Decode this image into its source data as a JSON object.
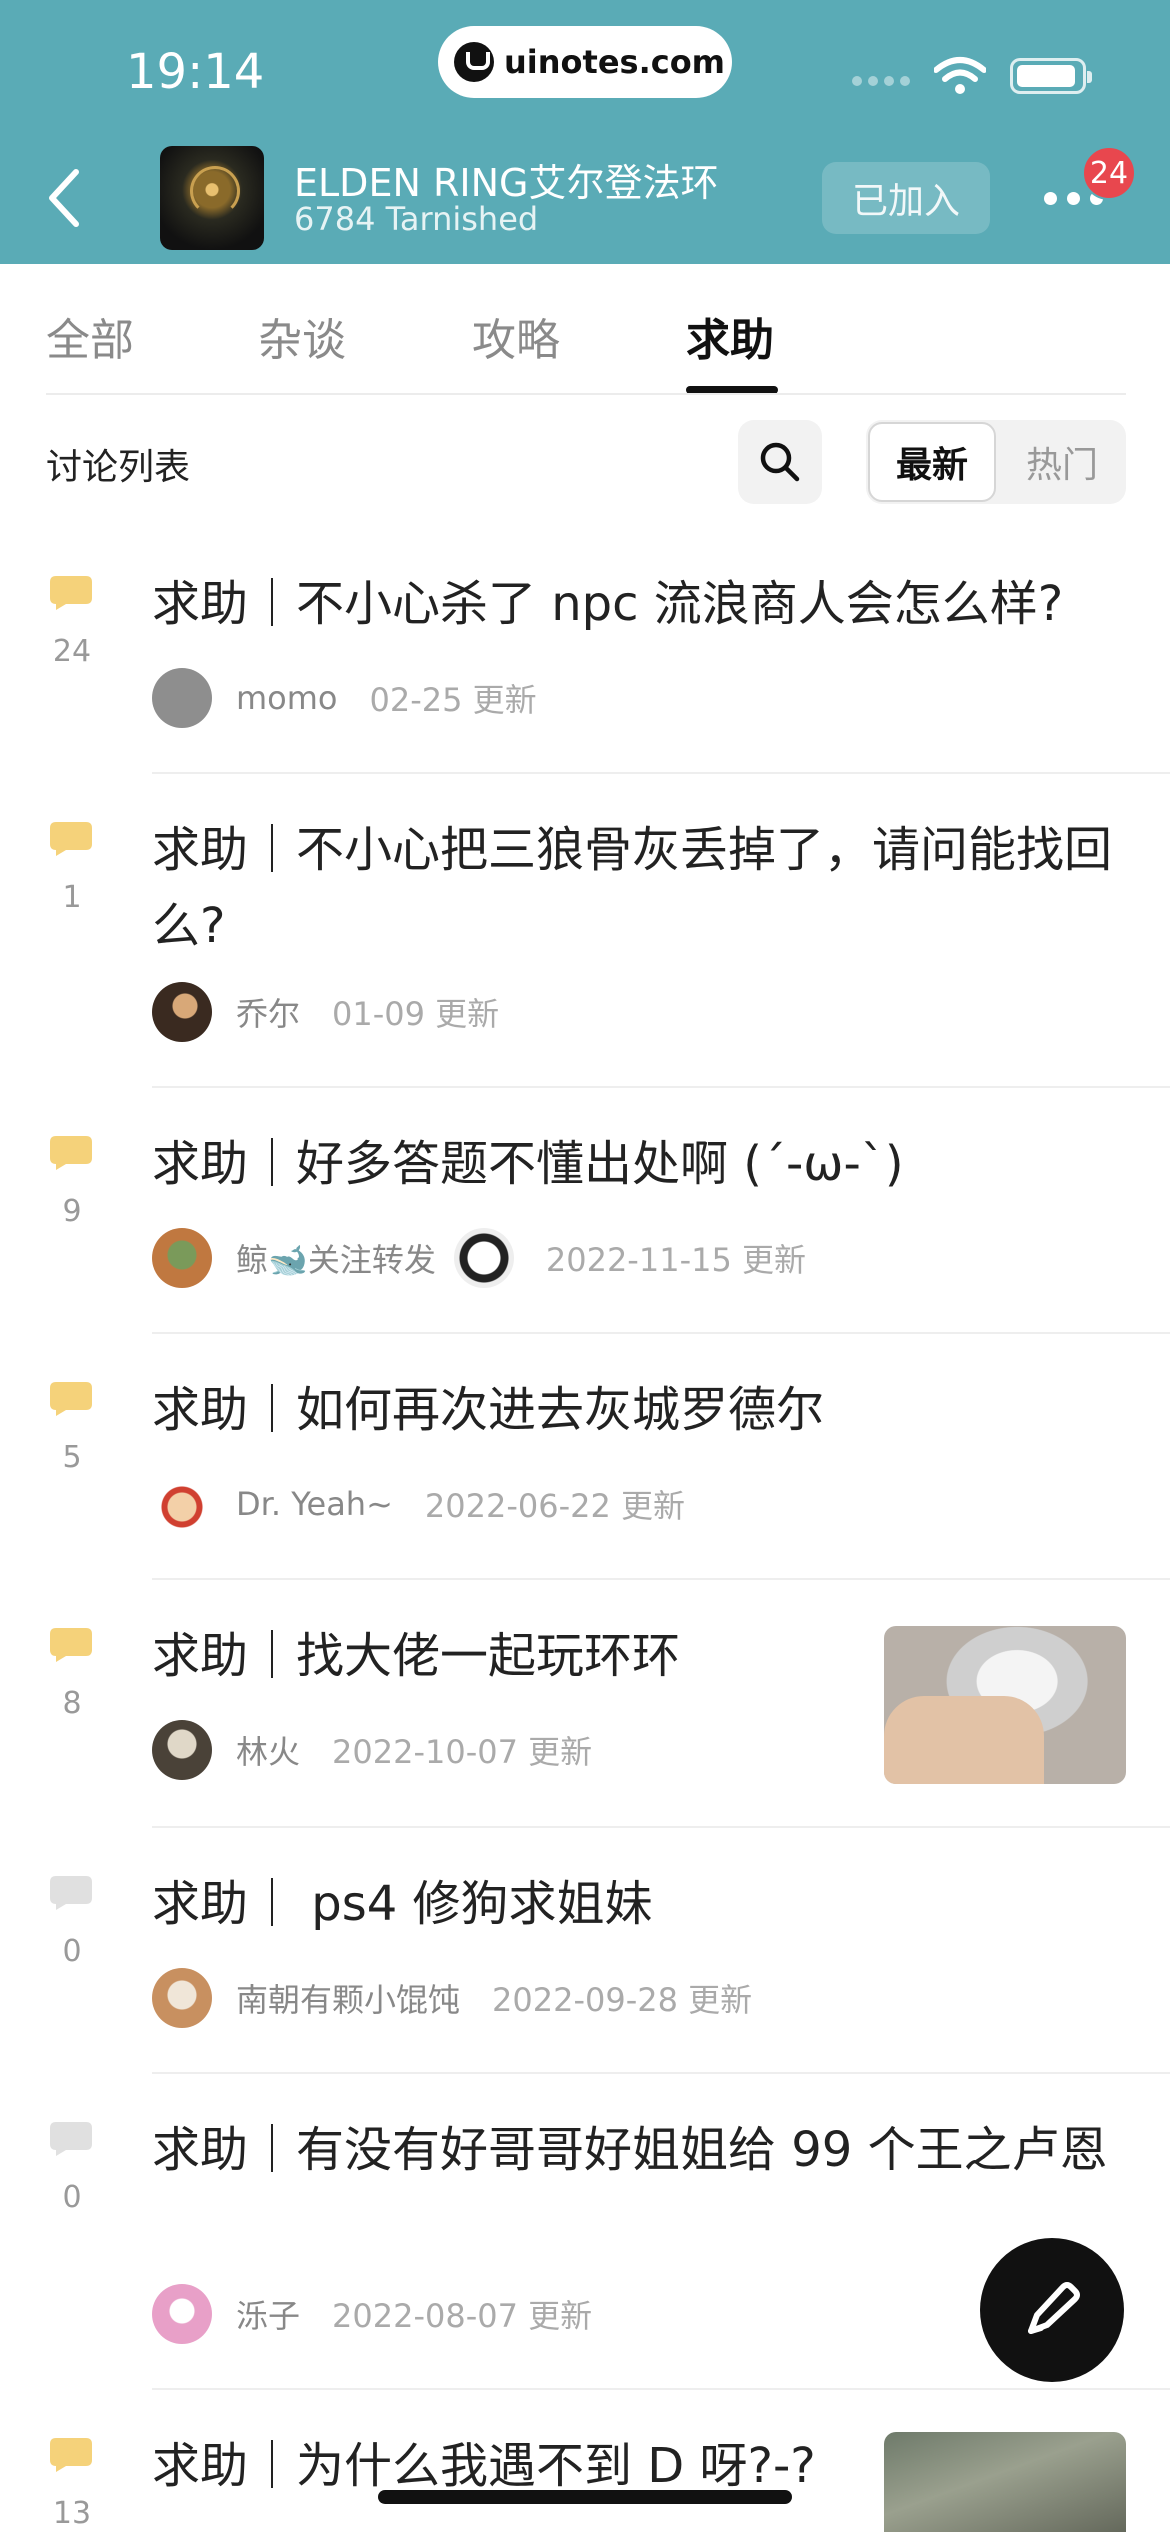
{
  "status_bar": {
    "time": "19:14",
    "url": "uinotes.com"
  },
  "header": {
    "group_name": "ELDEN RING艾尔登法环",
    "member_count": "6784 Tarnished",
    "joined_label": "已加入",
    "notification_badge": "24",
    "accent_color": "#5aabb6"
  },
  "tabs": [
    {
      "label": "全部",
      "active": false
    },
    {
      "label": "杂谈",
      "active": false
    },
    {
      "label": "攻略",
      "active": false
    },
    {
      "label": "求助",
      "active": true
    }
  ],
  "list": {
    "title": "讨论列表",
    "sort_options": [
      "最新",
      "热门"
    ],
    "selected_sort": "最新"
  },
  "posts": [
    {
      "title": "求助｜不小心杀了 npc 流浪商人会怎么样?",
      "comments": "24",
      "author": "momo",
      "time": "02-25 更新",
      "hot": true,
      "has_thumb": false
    },
    {
      "title": "求助｜不小心把三狼骨灰丢掉了，请问能找回么?",
      "comments": "1",
      "author": "乔尔",
      "time": "01-09 更新",
      "hot": true,
      "has_thumb": false
    },
    {
      "title": "求助｜好多答题不懂出处啊 (´-ω-`)",
      "comments": "9",
      "author": "鲸🐋关注转发",
      "time": "2022-11-15 更新",
      "hot": true,
      "has_thumb": false
    },
    {
      "title": "求助｜如何再次进去灰城罗德尔",
      "comments": "5",
      "author": "Dr. Yeah~",
      "time": "2022-06-22 更新",
      "hot": true,
      "has_thumb": false
    },
    {
      "title": "求助｜找大佬一起玩环环",
      "comments": "8",
      "author": "林火",
      "time": "2022-10-07 更新",
      "hot": true,
      "has_thumb": true
    },
    {
      "title": "求助｜ ps4 修狗求姐妹",
      "comments": "0",
      "author": "南朝有颗小馄饨",
      "time": "2022-09-28 更新",
      "hot": false,
      "has_thumb": false
    },
    {
      "title": "求助｜有没有好哥哥好姐姐给 99 个王之卢恩",
      "comments": "0",
      "author": "泺子",
      "time": "2022-08-07 更新",
      "hot": false,
      "has_thumb": false
    },
    {
      "title": "求助｜为什么我遇不到 D 呀?-?",
      "comments": "13",
      "author": "",
      "time": "",
      "hot": true,
      "has_thumb": true
    }
  ],
  "colors": {
    "hot_comment": "#f5d27a",
    "cold_comment": "#e0e0e0"
  }
}
